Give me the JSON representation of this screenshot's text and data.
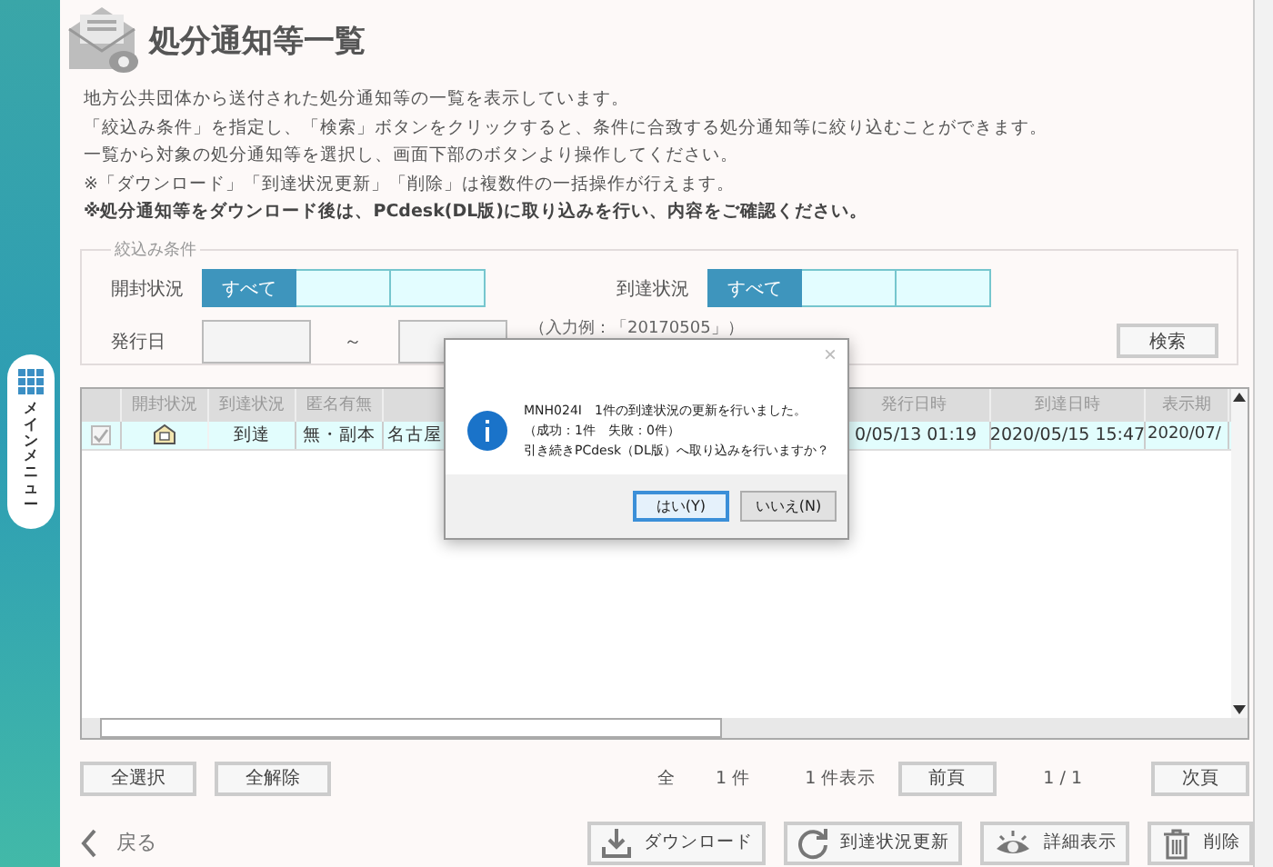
{
  "side_menu": {
    "label": "メインメニュー"
  },
  "header": {
    "title": "処分通知等一覧"
  },
  "description": [
    {
      "text": "地方公共団体から送付された処分通知等の一覧を表示しています。",
      "emphasis": false
    },
    {
      "text": "「絞込み条件」を指定し、「検索」ボタンをクリックすると、条件に合致する処分通知等に絞り込むことができます。",
      "emphasis": false
    },
    {
      "text": "一覧から対象の処分通知等を選択し、画面下部のボタンより操作してください。",
      "emphasis": false
    },
    {
      "text": "※「ダウンロード」「到達状況更新」「削除」は複数件の一括操作が行えます。",
      "emphasis": false
    },
    {
      "text": "※処分通知等をダウンロード後は、PCdesk(DL版)に取り込みを行い、内容をご確認ください。",
      "emphasis": true
    }
  ],
  "filter": {
    "legend": "絞込み条件",
    "groups": [
      {
        "label": "開封状況",
        "options": [
          {
            "label": "すべて",
            "selected": true
          },
          {
            "selected": false
          },
          {
            "selected": false
          }
        ]
      },
      {
        "label": "到達状況",
        "options": [
          {
            "label": "すべて",
            "selected": true
          },
          {
            "selected": false
          },
          {
            "selected": false
          }
        ]
      }
    ],
    "issue_date": {
      "label": "発行日",
      "separator": "～",
      "hint": "（入力例：「20170505」）"
    },
    "search_button": "検索"
  },
  "table": {
    "columns": [
      "",
      "開封状況",
      "到達状況",
      "匿名有無",
      "",
      "発行日時",
      "到達日時",
      "表示期"
    ],
    "rows": [
      {
        "checked": true,
        "opened": true,
        "cells": [
          "",
          "",
          "到達",
          "無・副本",
          "名古屋",
          "0/05/13 01:19",
          "2020/05/15 15:47",
          "2020/07/"
        ]
      }
    ]
  },
  "selection_buttons": [
    "全選択",
    "全解除"
  ],
  "pagination": {
    "total_label": "全",
    "total": "1 件",
    "shown": "1 件表示",
    "prev": "前頁",
    "page": "1 / 1",
    "next": "次頁"
  },
  "back": "戻る",
  "actions": [
    {
      "kind": "download",
      "label": "ダウンロード"
    },
    {
      "kind": "refresh",
      "label": "到達状況更新"
    },
    {
      "kind": "view",
      "label": "詳細表示"
    },
    {
      "kind": "delete",
      "label": "削除"
    }
  ],
  "dialog": {
    "close": "×",
    "lines": [
      "MNH024I　1件の到達状況の更新を行いました。",
      "（成功：1件　失敗：0件）",
      "引き続きPCdesk（DL版）へ取り込みを行いますか？"
    ],
    "buttons": [
      {
        "label": "はい(Y)",
        "selected": true
      },
      {
        "label": "いいえ(N)",
        "selected": false
      }
    ]
  }
}
